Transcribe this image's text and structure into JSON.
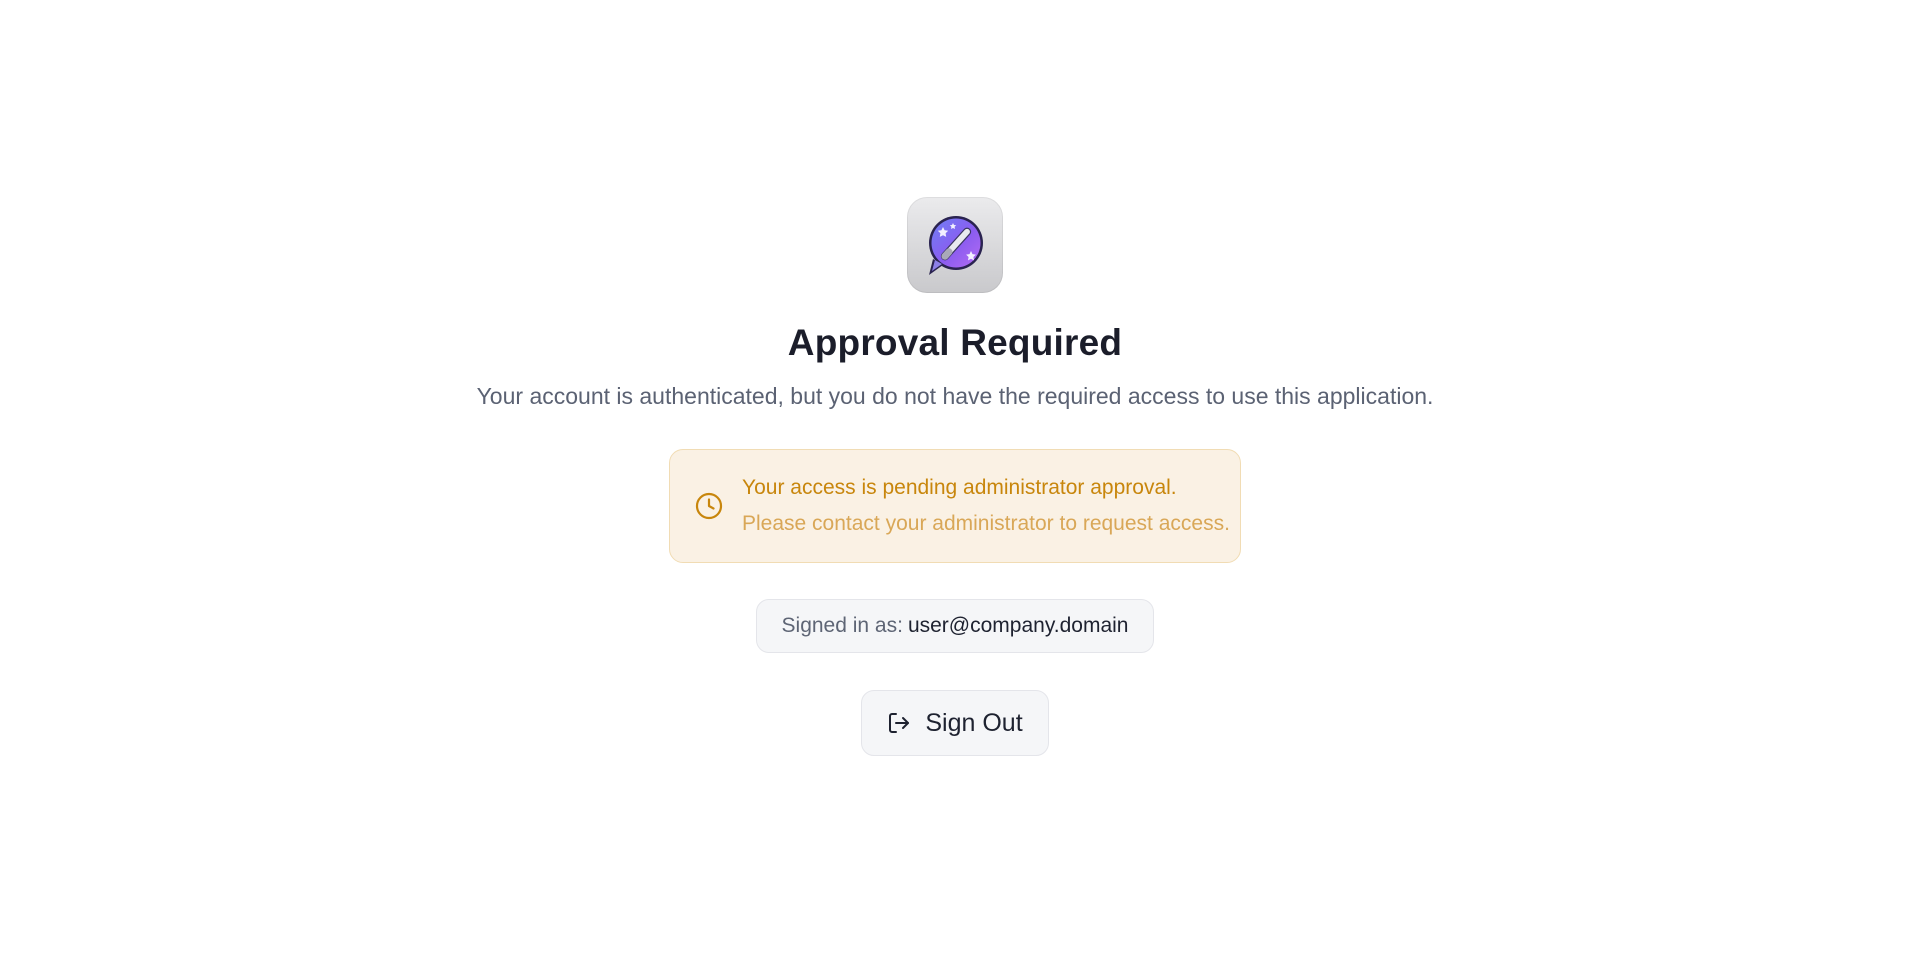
{
  "title": "Approval Required",
  "subtitle": "Your account is authenticated, but you do not have the required access to use this application.",
  "notice": {
    "icon": "clock-icon",
    "line1": "Your access is pending administrator approval.",
    "line2": "Please contact your administrator to request access."
  },
  "signed_in": {
    "label": "Signed in as:",
    "email": "user@company.domain"
  },
  "sign_out": {
    "icon": "sign-out-icon",
    "label": "Sign Out"
  },
  "colors": {
    "warning_text": "#c8860c",
    "warning_subtext": "#d9a757",
    "warning_bg": "#faf1e4",
    "warning_border": "#f1dcb4",
    "logo_purple": "#8a5cf0"
  }
}
